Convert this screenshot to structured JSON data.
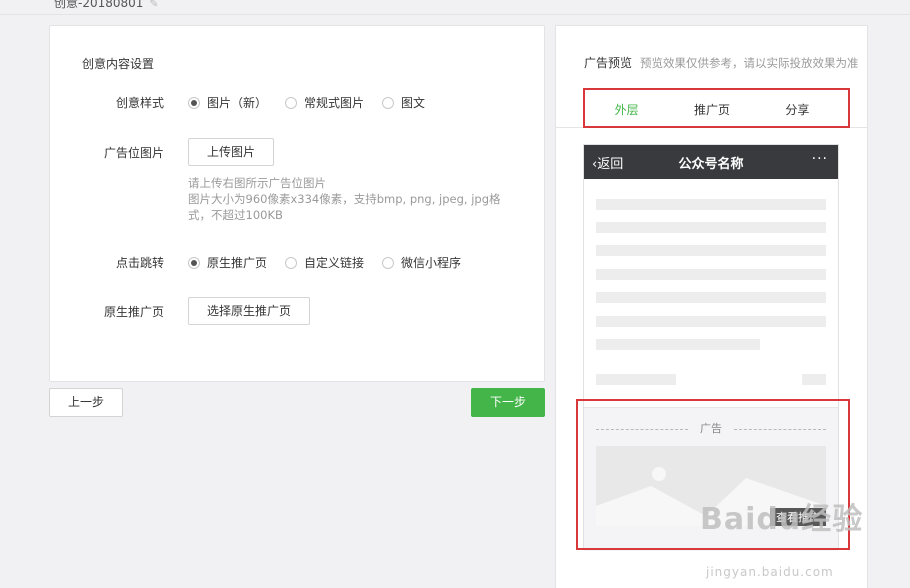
{
  "page": {
    "top_title": "创意-20180801"
  },
  "form": {
    "section_title": "创意内容设置",
    "style_label": "创意样式",
    "style_options": [
      "图片（新）",
      "常规式图片",
      "图文"
    ],
    "style_selected": "图片（新）",
    "image_label": "广告位图片",
    "upload_button": "上传图片",
    "upload_tip_line1": "请上传右图所示广告位图片",
    "upload_tip_line2": "图片大小为960像素x334像素，支持bmp, png, jpeg, jpg格式，不超过100KB",
    "jump_label": "点击跳转",
    "jump_options": [
      "原生推广页",
      "自定义链接",
      "微信小程序"
    ],
    "jump_selected": "原生推广页",
    "native_label": "原生推广页",
    "native_button": "选择原生推广页"
  },
  "footer": {
    "prev_label": "上一步",
    "next_label": "下一步"
  },
  "preview": {
    "title": "广告预览",
    "hint": "预览效果仅供参考，请以实际投放效果为准",
    "tabs": [
      "外层",
      "推广页",
      "分享"
    ],
    "active_tab": "外层",
    "phone_back": "返回",
    "phone_title": "公众号名称",
    "phone_more": "···",
    "ad_label": "广告",
    "ad_cta": "查看推广"
  },
  "watermark": {
    "text": "Baidu经验",
    "sub": "jingyan.baidu.com"
  },
  "colors": {
    "accent_green": "#44b549",
    "highlight_red": "#d9383b",
    "phone_header": "#393a3e"
  }
}
